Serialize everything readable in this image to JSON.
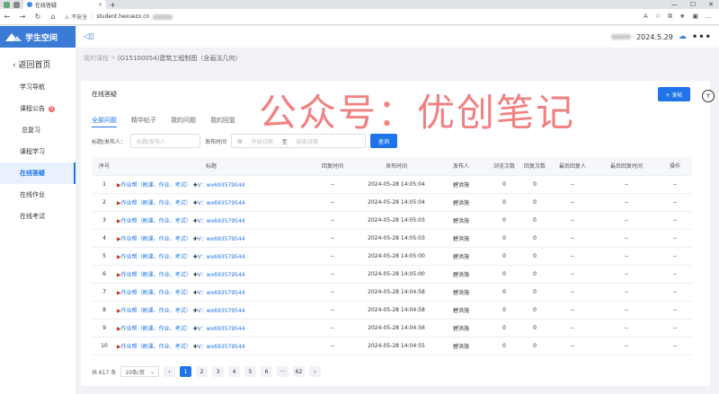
{
  "browser": {
    "tab_title": "在线答疑",
    "tab_close": "×",
    "new_tab": "+",
    "back": "←",
    "forward": "→",
    "reload": "↻",
    "home": "⌂",
    "security": "⚠ 不安全",
    "url": "student.hexuezx.cn",
    "win_min": "—",
    "win_max": "☐",
    "win_close": "✕"
  },
  "brand": {
    "name": "学生空间"
  },
  "sidebar": {
    "back_label": "返回首页",
    "items": [
      {
        "label": "学习导航"
      },
      {
        "label": "课程公告",
        "badge": "0"
      },
      {
        "label": "总复习"
      },
      {
        "label": "课程学习"
      },
      {
        "label": "在线答疑"
      },
      {
        "label": "在线作业"
      },
      {
        "label": "在线考试"
      }
    ]
  },
  "topbar": {
    "date": "2024.5.29",
    "more": "•••"
  },
  "breadcrumb": {
    "root": "我的课程",
    "sep": ">",
    "course": "(G15100054)建筑工程制图（含画法几何）"
  },
  "card": {
    "title": "在线答疑",
    "publish_label": "+ 发帖",
    "edge_icon": "Y"
  },
  "tabs": [
    "全部问题",
    "精华帖子",
    "我的问题",
    "我的回复"
  ],
  "filter": {
    "poster_label": "标题/发布人：",
    "poster_placeholder": "标题/发布人",
    "time_label": "发布时间",
    "start_placeholder": "开始日期",
    "range_sep": "至",
    "end_placeholder": "结束日期",
    "query_label": "查询"
  },
  "table": {
    "headers": [
      "序号",
      "标题",
      "回复时间",
      "发布时间",
      "发布人",
      "浏览次数",
      "回复次数",
      "最后回复人",
      "最后回复时间",
      "操作"
    ],
    "rows": [
      {
        "no": "1",
        "title": "作业帮（刷课、作业、考试）",
        "contact": "V：wx693579544",
        "reply_time": "--",
        "time": "2024-05-28 14:05:04",
        "poster": "碧洪施",
        "views": "0",
        "replies": "0",
        "last_user": "--",
        "last_time": "--",
        "op": "--"
      },
      {
        "no": "2",
        "title": "作业帮（刷课、作业、考试）",
        "contact": "V：wx693579544",
        "reply_time": "--",
        "time": "2024-05-28 14:05:04",
        "poster": "碧洪施",
        "views": "0",
        "replies": "0",
        "last_user": "--",
        "last_time": "--",
        "op": "--"
      },
      {
        "no": "3",
        "title": "作业帮（刷课、作业、考试）",
        "contact": "V：wx693579544",
        "reply_time": "--",
        "time": "2024-05-28 14:05:03",
        "poster": "碧洪施",
        "views": "0",
        "replies": "0",
        "last_user": "--",
        "last_time": "--",
        "op": "--"
      },
      {
        "no": "4",
        "title": "作业帮（刷课、作业、考试）",
        "contact": "V：wx693579544",
        "reply_time": "--",
        "time": "2024-05-28 14:05:03",
        "poster": "碧洪施",
        "views": "0",
        "replies": "0",
        "last_user": "--",
        "last_time": "--",
        "op": "--"
      },
      {
        "no": "5",
        "title": "作业帮（刷课、作业、考试）",
        "contact": "V：wx693579544",
        "reply_time": "--",
        "time": "2024-05-28 14:05:00",
        "poster": "碧洪施",
        "views": "0",
        "replies": "0",
        "last_user": "--",
        "last_time": "--",
        "op": "--"
      },
      {
        "no": "6",
        "title": "作业帮（刷课、作业、考试）",
        "contact": "V：wx693579544",
        "reply_time": "--",
        "time": "2024-05-28 14:05:00",
        "poster": "碧洪施",
        "views": "0",
        "replies": "0",
        "last_user": "--",
        "last_time": "--",
        "op": "--"
      },
      {
        "no": "7",
        "title": "作业帮（刷课、作业、考试）",
        "contact": "V：wx693579544",
        "reply_time": "--",
        "time": "2024-05-28 14:04:58",
        "poster": "碧洪施",
        "views": "0",
        "replies": "0",
        "last_user": "--",
        "last_time": "--",
        "op": "--"
      },
      {
        "no": "8",
        "title": "作业帮（刷课、作业、考试）",
        "contact": "V：wx693579544",
        "reply_time": "--",
        "time": "2024-05-28 14:04:58",
        "poster": "碧洪施",
        "views": "0",
        "replies": "0",
        "last_user": "--",
        "last_time": "--",
        "op": "--"
      },
      {
        "no": "9",
        "title": "作业帮（刷课、作业、考试）",
        "contact": "V：wx693579544",
        "reply_time": "--",
        "time": "2024-05-28 14:04:56",
        "poster": "碧洪施",
        "views": "0",
        "replies": "0",
        "last_user": "--",
        "last_time": "--",
        "op": "--"
      },
      {
        "no": "10",
        "title": "作业帮（刷课、作业、考试）",
        "contact": "V：wx693579544",
        "reply_time": "--",
        "time": "2024-05-28 14:04:55",
        "poster": "碧洪施",
        "views": "0",
        "replies": "0",
        "last_user": "--",
        "last_time": "--",
        "op": "--"
      }
    ]
  },
  "pager": {
    "total": "共 617 条",
    "page_size": "10条/页",
    "prev": "‹",
    "pages": [
      "1",
      "2",
      "3",
      "4",
      "5",
      "6",
      "···",
      "62"
    ],
    "next": "›"
  },
  "watermark": "公众号：优创笔记",
  "colors": {
    "primary": "#1e74e8",
    "brand": "#3a7bd5",
    "watermark": "#f06c6c"
  }
}
